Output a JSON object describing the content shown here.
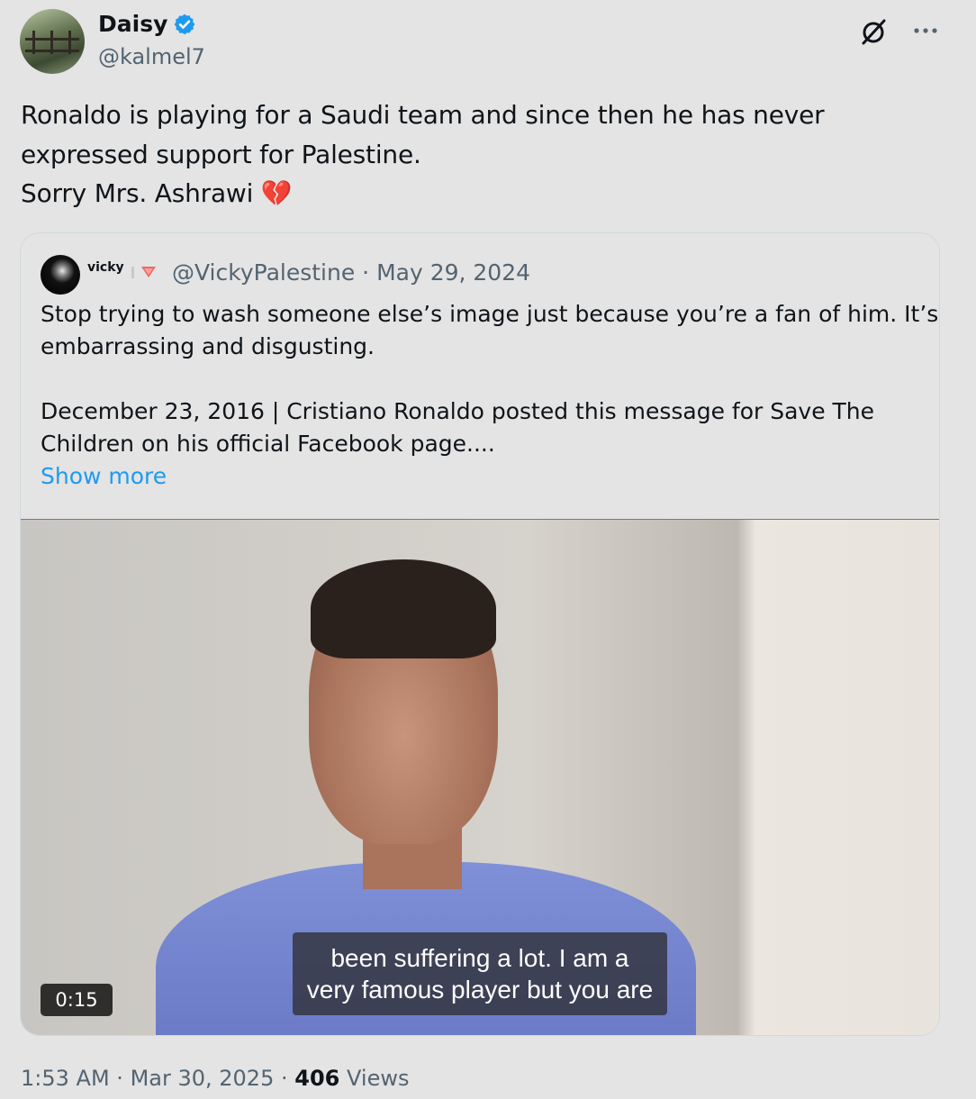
{
  "author": {
    "display_name": "Daisy",
    "handle": "@kalmel7"
  },
  "tweet": {
    "lines": [
      "Ronaldo is playing for a Saudi team and since then he has never",
      "expressed support for Palestine.",
      "Sorry Mrs. Ashrawi 💔"
    ]
  },
  "quote": {
    "display_name": "vicky",
    "meta": "@VickyPalestine · May 29, 2024",
    "text_lines": [
      "Stop trying to wash someone else’s image just because you’re a fan of him. It’s",
      "embarrassing and disgusting.",
      "",
      "December 23, 2016 | Cristiano Ronaldo posted this message for Save The",
      "Children on his official Facebook page...."
    ],
    "show_more": "Show more",
    "video": {
      "caption_line1": "been suffering a lot. I am a",
      "caption_line2": "very famous player but you are",
      "duration": "0:15"
    }
  },
  "footer": {
    "time": "1:53 AM",
    "date": "Mar 30, 2025",
    "views_count": "406",
    "views_label": "Views"
  },
  "colors": {
    "background": "#e4e4e4",
    "verified": "#1d9bf0",
    "link": "#1d9bf0",
    "secondary_text": "#536471"
  },
  "icons": [
    "verified-badge-icon",
    "grok-icon",
    "more-icon",
    "broken-heart-emoji",
    "flag-icon"
  ]
}
